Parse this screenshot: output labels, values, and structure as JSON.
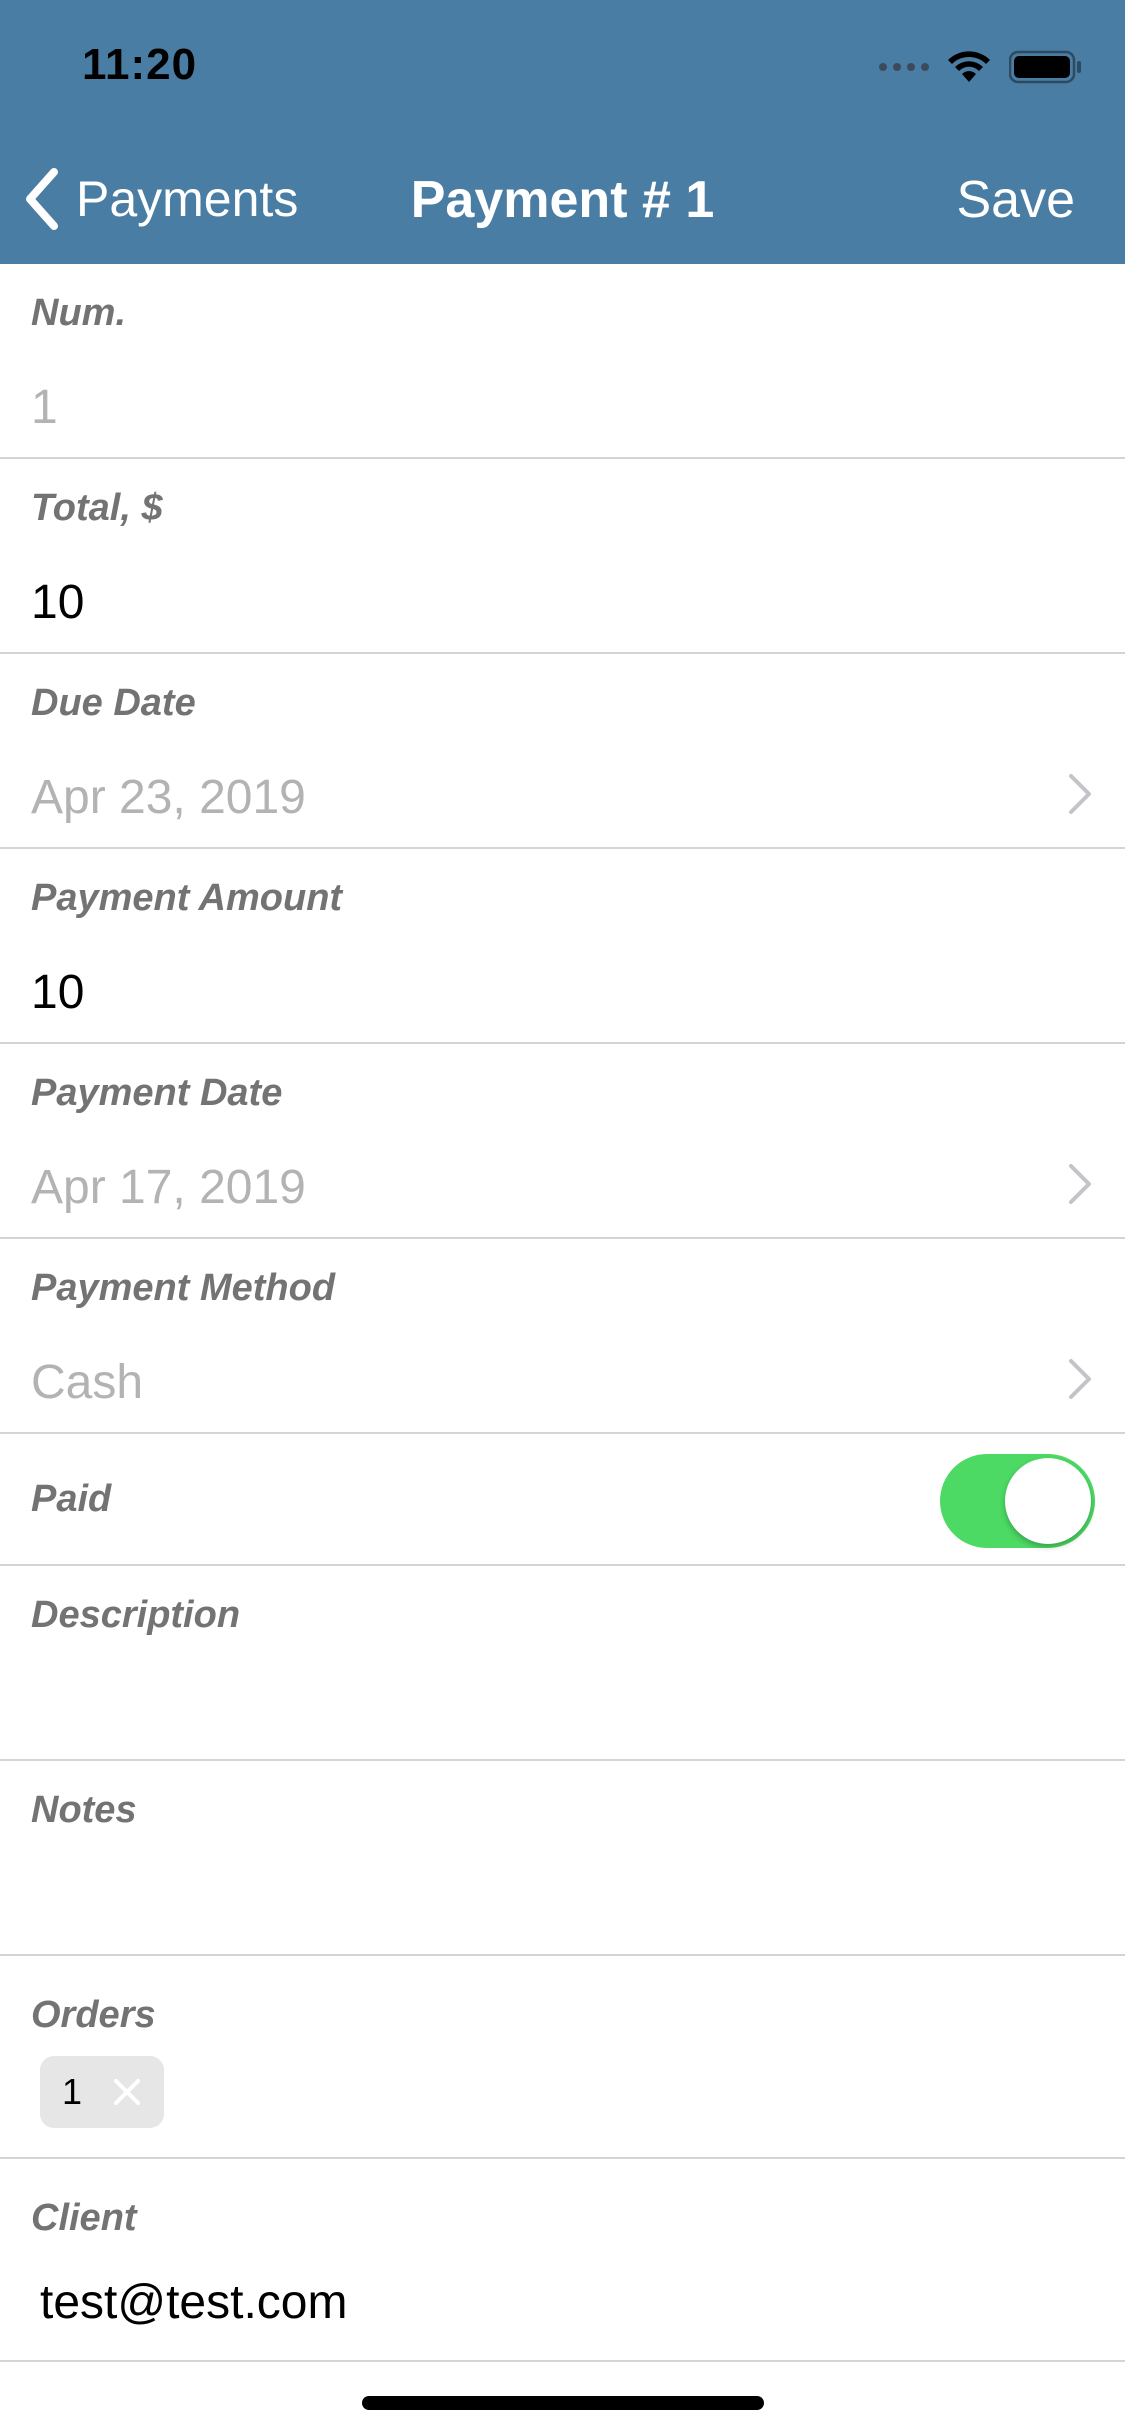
{
  "status_bar": {
    "time": "11:20"
  },
  "nav": {
    "back_label": "Payments",
    "title": "Payment # 1",
    "save_label": "Save"
  },
  "fields": {
    "num": {
      "label": "Num.",
      "value": "1"
    },
    "total": {
      "label": "Total, $",
      "value": "10"
    },
    "due_date": {
      "label": "Due Date",
      "value": "Apr 23, 2019"
    },
    "payment_amount": {
      "label": "Payment Amount",
      "value": "10"
    },
    "payment_date": {
      "label": "Payment Date",
      "value": "Apr 17, 2019"
    },
    "payment_method": {
      "label": "Payment Method",
      "value": "Cash"
    },
    "paid": {
      "label": "Paid",
      "on": true
    },
    "description": {
      "label": "Description",
      "value": ""
    },
    "notes": {
      "label": "Notes",
      "value": ""
    },
    "orders": {
      "label": "Orders",
      "chips": [
        "1"
      ]
    },
    "client": {
      "label": "Client",
      "value": "test@test.com"
    }
  },
  "colors": {
    "header_bg": "#4a7da3",
    "toggle_on": "#4cd964",
    "label_gray": "#737373",
    "value_muted": "#b3b3b3"
  },
  "icons": [
    "back-chevron-icon",
    "wifi-icon",
    "battery-icon",
    "chevron-right-icon",
    "close-icon"
  ]
}
